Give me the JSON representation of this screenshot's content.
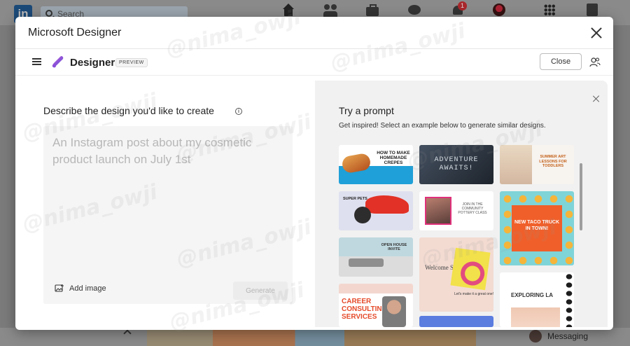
{
  "background": {
    "search_placeholder": "Search",
    "notification_count": "1",
    "messaging_label": "Messaging"
  },
  "modal": {
    "title": "Microsoft Designer"
  },
  "designer": {
    "brand": "Designer",
    "preview_badge": "PREVIEW",
    "close_label": "Close"
  },
  "prompt": {
    "heading": "Describe the design you'd like to create",
    "placeholder": "An Instagram post about my cosmetic product launch on July 1st",
    "add_image_label": "Add image",
    "generate_label": "Generate"
  },
  "suggestions": {
    "heading": "Try a prompt",
    "subheading": "Get inspired! Select an example below to generate similar designs.",
    "tiles": {
      "crepes": "HOW TO MAKE HOMEMADE CREPES",
      "adventure": "ADVENTURE AWAITS!",
      "summer_art": "SUMMER ART LESSONS FOR TODDLERS",
      "pets": "SUPER PETS",
      "birthday": "JOIN IN THE COMMUNITY POTTERY CLASS",
      "taco": "NEW TACO TRUCK IN TOWN!",
      "open_house": "OPEN HOUSE INVITE",
      "welcome": "Welcome Summer 2023!",
      "welcome_note": "Let's make it a great one!",
      "explore": "EXPLORING LA",
      "career": "CAREER CONSULTING SERVICES"
    }
  },
  "watermark": "@nima_owji",
  "colors": {
    "accent_blue": "#1fa0d8",
    "taco_orange": "#f05f2a",
    "career_orange": "#e54a2a",
    "notification_red": "#a8272b"
  }
}
